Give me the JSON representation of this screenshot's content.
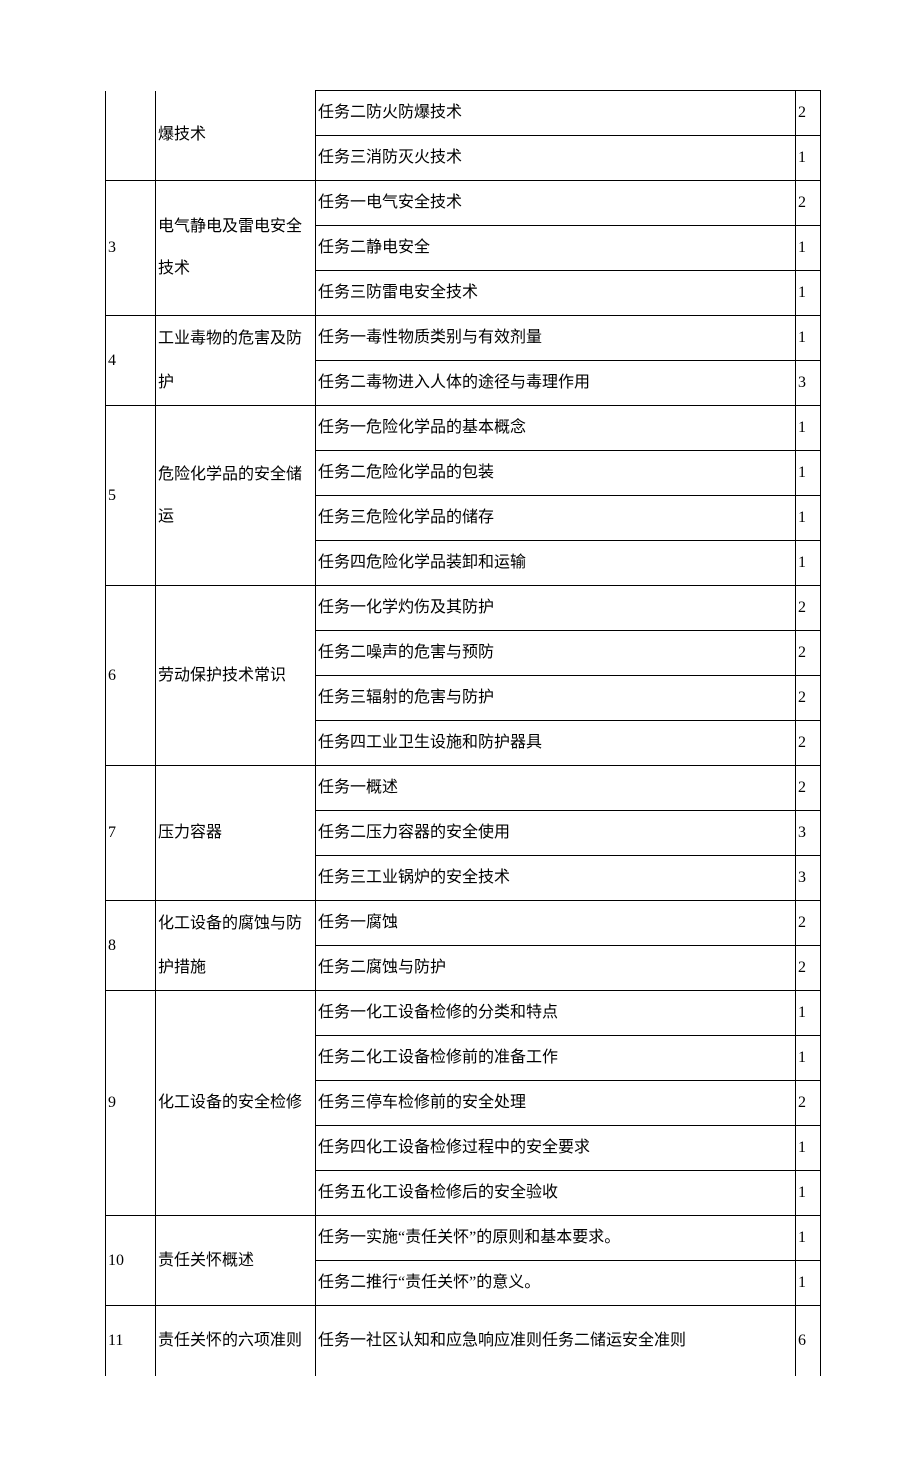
{
  "rows": [
    {
      "num": "",
      "topic": "爆技术",
      "task": "任务二防火防爆技术",
      "hours": "2",
      "firstOfGroup": true,
      "numRowspan": 2,
      "topicRowspan": 2,
      "numContinuation": true,
      "topicContinuation": true
    },
    {
      "task": "任务三消防灭火技术",
      "hours": "1"
    },
    {
      "num": "3",
      "topic": "电气静电及雷电安全技术",
      "task": "任务一电气安全技术",
      "hours": "2",
      "firstOfGroup": true,
      "numRowspan": 3,
      "topicRowspan": 3,
      "topicClass": "topic"
    },
    {
      "task": "任务二静电安全",
      "hours": "1"
    },
    {
      "task": "任务三防雷电安全技术",
      "hours": "1"
    },
    {
      "num": "4",
      "topic": "工业毒物的危害及防护",
      "task": "任务一毒性物质类别与有效剂量",
      "hours": "1",
      "firstOfGroup": true,
      "numRowspan": 2,
      "topicRowspan": 2,
      "topicClass": "overflow"
    },
    {
      "task": "任务二毒物进入人体的途径与毒理作用",
      "hours": "3"
    },
    {
      "num": "5",
      "topic": "危险化学品的安全储运",
      "task": "任务一危险化学品的基本概念",
      "hours": "1",
      "firstOfGroup": true,
      "numRowspan": 4,
      "topicRowspan": 4,
      "topicClass": "topic"
    },
    {
      "task": "任务二危险化学品的包装",
      "hours": "1"
    },
    {
      "task": "任务三危险化学品的储存",
      "hours": "1"
    },
    {
      "task": "任务四危险化学品装卸和运输",
      "hours": "1"
    },
    {
      "num": "6",
      "topic": "劳动保护技术常识",
      "task": "任务一化学灼伤及其防护",
      "hours": "2",
      "firstOfGroup": true,
      "numRowspan": 4,
      "topicRowspan": 4
    },
    {
      "task": "任务二噪声的危害与预防",
      "hours": "2"
    },
    {
      "task": "任务三辐射的危害与防护",
      "hours": "2"
    },
    {
      "task": "任务四工业卫生设施和防护器具",
      "hours": "2"
    },
    {
      "num": "7",
      "topic": "压力容器",
      "task": "任务一概述",
      "hours": "2",
      "firstOfGroup": true,
      "numRowspan": 3,
      "topicRowspan": 3
    },
    {
      "task": "任务二压力容器的安全使用",
      "hours": "3"
    },
    {
      "task": "任务三工业锅炉的安全技术",
      "hours": "3"
    },
    {
      "num": "8",
      "topic": "化工设备的腐蚀与防护措施",
      "task": "任务一腐蚀",
      "hours": "2",
      "firstOfGroup": true,
      "numRowspan": 2,
      "topicRowspan": 2,
      "topicClass": "overflow"
    },
    {
      "task": "任务二腐蚀与防护",
      "hours": "2"
    },
    {
      "num": "9",
      "topic": "化工设备的安全检修",
      "task": "任务一化工设备检修的分类和特点",
      "hours": "1",
      "firstOfGroup": true,
      "numRowspan": 5,
      "topicRowspan": 5,
      "topicClass": "topic"
    },
    {
      "task": "任务二化工设备检修前的准备工作",
      "hours": "1"
    },
    {
      "task": "任务三停车检修前的安全处理",
      "hours": "2"
    },
    {
      "task": "任务四化工设备检修过程中的安全要求",
      "hours": "1"
    },
    {
      "task": "任务五化工设备检修后的安全验收",
      "hours": "1"
    },
    {
      "num": "10",
      "topic": "责任关怀概述",
      "task": "任务一实施“责任关怀”的原则和基本要求。",
      "hours": "1",
      "firstOfGroup": true,
      "numRowspan": 2,
      "topicRowspan": 2
    },
    {
      "task": "任务二推行“责任关怀”的意义。",
      "hours": "1"
    },
    {
      "num": "11",
      "topic": "责任关怀的六项准则",
      "task": "任务一社区认知和应急响应准则任务二储运安全准则",
      "hours": "6",
      "firstOfGroup": true,
      "numRowspan": 1,
      "topicRowspan": 1,
      "topicClass": "overflow",
      "numNoBottom": true,
      "topicNoBottom": true,
      "taskNoBottom": true,
      "hoursNoBottom": true,
      "tall": true
    }
  ]
}
